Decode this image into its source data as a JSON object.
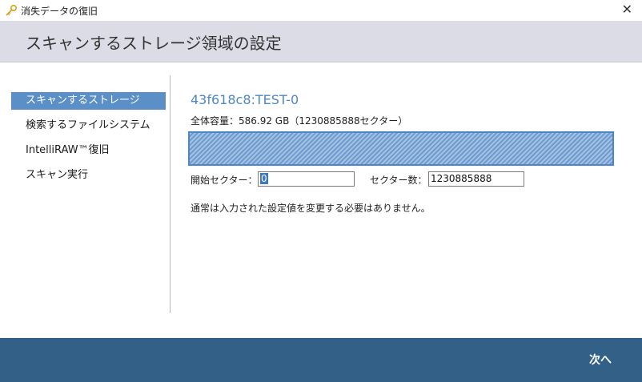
{
  "window": {
    "title": "消失データの復旧",
    "close_glyph": "✕"
  },
  "header": {
    "heading": "スキャンするストレージ領域の設定"
  },
  "sidebar": {
    "items": [
      {
        "label": "スキャンするストレージ",
        "active": true
      },
      {
        "label": "検索するファイルシステム",
        "active": false
      },
      {
        "label": "IntelliRAW™復旧",
        "active": false
      },
      {
        "label": "スキャン実行",
        "active": false
      }
    ]
  },
  "main": {
    "disk_name": "43f618c8:TEST-0",
    "capacity": "全体容量：586.92 GB（1230885888セクター）",
    "start_sector_label": "開始セクター：",
    "start_sector_value": "0",
    "sector_count_label": "セクター数：",
    "sector_count_value": "1230885888",
    "note": "通常は入力された設定値を変更する必要はありません。"
  },
  "footer": {
    "next_label": "次へ"
  },
  "colors": {
    "accent": "#5b8fc7",
    "header_bg": "#dcdce6",
    "footer_bg": "#326087",
    "disk_name": "#4f87c2"
  },
  "icons": {
    "app": "key-icon",
    "close": "close-icon"
  }
}
